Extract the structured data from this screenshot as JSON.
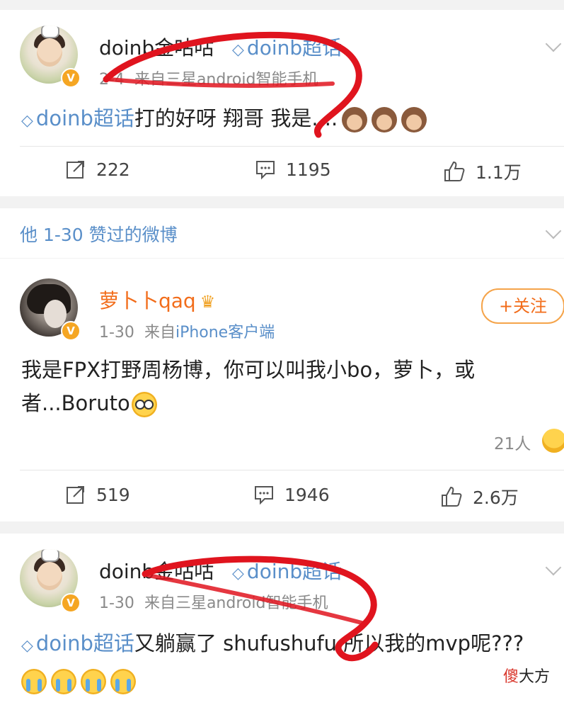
{
  "post1": {
    "author": "doinb金咕咕",
    "chaohua": "doinb超话",
    "time": "2-4",
    "source_prefix": "来自",
    "source": "三星android智能手机",
    "tag": "doinb超话",
    "text": "打的好呀 翔哥 我是....",
    "reposts": "222",
    "comments": "1195",
    "likes": "1.1万"
  },
  "section": {
    "title": "他 1-30 赞过的微博"
  },
  "post2": {
    "author": "萝卜卜qaq",
    "time": "1-30",
    "source_prefix": "来自",
    "source": "iPhone客户端",
    "follow_label": "+关注",
    "text_line1": "我是FPX打野周杨博，你可以叫我小bo，萝卜，或",
    "text_line2": "者...Boruto",
    "likers": "21人",
    "reposts": "519",
    "comments": "1946",
    "likes": "2.6万"
  },
  "post3": {
    "author": "doinb金咕咕",
    "chaohua": "doinb超话",
    "time": "1-30",
    "source_prefix": "来自",
    "source": "三星android智能手机",
    "tag": "doinb超话",
    "text": "又躺赢了 shufushufu 所以我的mvp呢???"
  },
  "watermark": {
    "red": "傻",
    "black": "大方"
  },
  "colors": {
    "link_blue": "#5a8fc9",
    "orange": "#f26d1b",
    "annotation_red": "#e0141e"
  }
}
